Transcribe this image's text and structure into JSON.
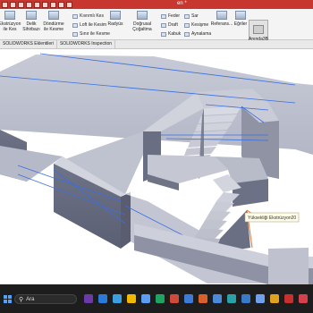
{
  "window": {
    "title": "en *"
  },
  "toolbar": {
    "items": [
      {
        "label": "Ekstrüzyon ile Kes",
        "icon": "extruded-cut-icon"
      },
      {
        "label": "Delik Sihirbazı",
        "icon": "hole-wizard-icon"
      },
      {
        "label": "Döndürme ile Kesme",
        "icon": "revolved-cut-icon"
      },
      {
        "label": "Kıvrımlı Kes",
        "icon": "swept-cut-icon"
      },
      {
        "label": "Loft ile Kesim",
        "icon": "lofted-cut-icon"
      },
      {
        "label": "Sınır ile Kesme",
        "icon": "boundary-cut-icon"
      },
      {
        "label": "Radyüs",
        "icon": "fillet-icon"
      },
      {
        "label": "Doğrusal Çoğaltma",
        "icon": "linear-pattern-icon"
      },
      {
        "label": "Feder",
        "icon": "rib-icon"
      },
      {
        "label": "Draft",
        "icon": "draft-icon"
      },
      {
        "label": "Kabuk",
        "icon": "shell-icon"
      },
      {
        "label": "Sar",
        "icon": "wrap-icon"
      },
      {
        "label": "Kesişme",
        "icon": "intersect-icon"
      },
      {
        "label": "Aynalama",
        "icon": "mirror-icon"
      },
      {
        "label": "Referans...",
        "icon": "reference-geometry-icon"
      },
      {
        "label": "Eğriler",
        "icon": "curves-icon"
      },
      {
        "label": "Anında3B",
        "icon": "instant3d-icon"
      }
    ]
  },
  "tabs": [
    "SOLIDWORKS Eklentileri",
    "SOLIDWORKS Inspection"
  ],
  "viewport": {
    "tooltip": "Yüksekliği Ekstrüzyon20"
  },
  "taskbar": {
    "search_placeholder": "Ara"
  }
}
